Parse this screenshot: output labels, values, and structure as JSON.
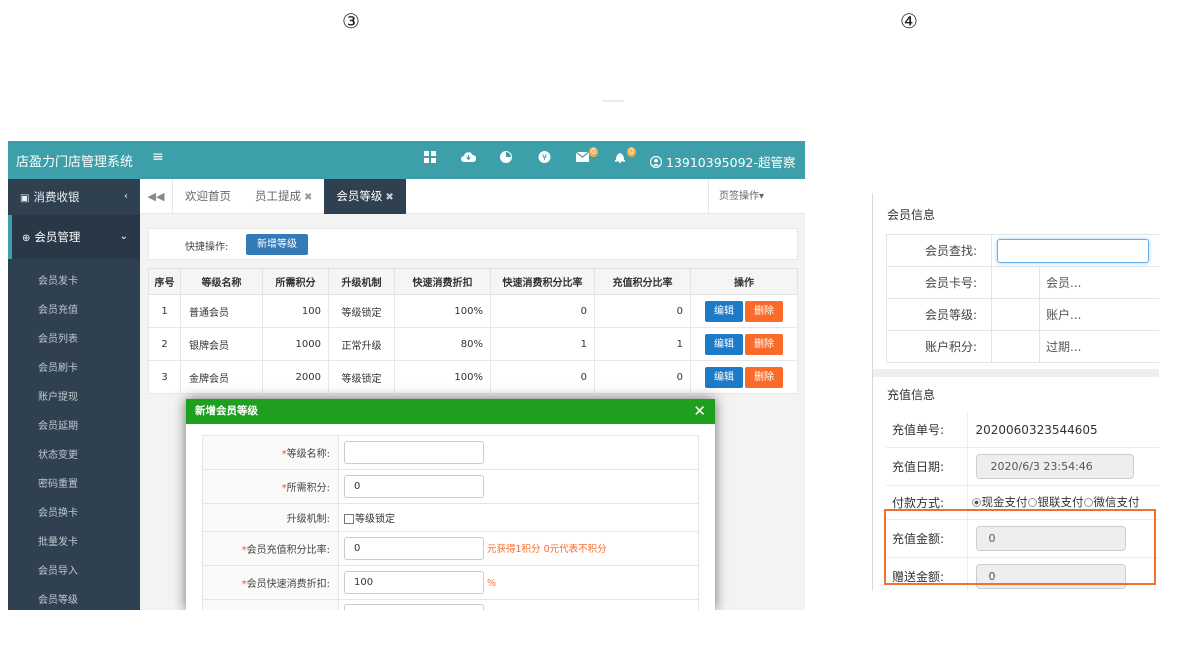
{
  "markers": {
    "left": "③",
    "right": "④"
  },
  "app": {
    "brand": "店盈力门店管理系统",
    "menu_toggle": "≡",
    "topbar_badges": {
      "mail": "0",
      "bell": "0"
    },
    "user": "13910395092-超管察"
  },
  "sidebar": {
    "groups": [
      {
        "label": "消费收银",
        "caret": "‹"
      },
      {
        "label": "会员管理",
        "caret": "⌄"
      }
    ],
    "items": [
      "会员发卡",
      "会员充值",
      "会员列表",
      "会员刷卡",
      "账户提现",
      "会员延期",
      "状态变更",
      "密码重置",
      "会员换卡",
      "批量发卡",
      "会员导入",
      "会员等级"
    ]
  },
  "tabs": {
    "nav_left": "◀◀",
    "items": [
      {
        "label": "欢迎首页",
        "closable": false
      },
      {
        "label": "员工提成",
        "closable": true
      },
      {
        "label": "会员等级",
        "closable": true
      }
    ],
    "close_glyph": "✖",
    "ops": "页签操作▾"
  },
  "quick": {
    "label": "快捷操作:",
    "button": "新增等级"
  },
  "grid": {
    "headers": [
      "序号",
      "等级名称",
      "所需积分",
      "升级机制",
      "快速消费折扣",
      "快速消费积分比率",
      "充值积分比率",
      "操作"
    ],
    "rows": [
      {
        "no": "1",
        "name": "普通会员",
        "points": "100",
        "mechanism": "等级锁定",
        "discount": "100%",
        "consume_ratio": "0",
        "recharge_ratio": "0"
      },
      {
        "no": "2",
        "name": "银牌会员",
        "points": "1000",
        "mechanism": "正常升级",
        "discount": "80%",
        "consume_ratio": "1",
        "recharge_ratio": "1"
      },
      {
        "no": "3",
        "name": "金牌会员",
        "points": "2000",
        "mechanism": "等级锁定",
        "discount": "100%",
        "consume_ratio": "0",
        "recharge_ratio": "0"
      }
    ],
    "edit_label": "编辑",
    "delete_label": "删除"
  },
  "dialog": {
    "title": "新增会员等级",
    "close": "✕",
    "fields": [
      {
        "required": "*",
        "label": "等级名称:",
        "value": ""
      },
      {
        "required": "*",
        "label": "所需积分:",
        "value": "0"
      },
      {
        "required": "",
        "label": "升级机制:",
        "checkbox": "等级锁定"
      },
      {
        "required": "*",
        "label": "会员充值积分比率:",
        "value": "0",
        "hint": "元获得1积分 0元代表不积分"
      },
      {
        "required": "*",
        "label": "会员快速消费折扣:",
        "value": "100",
        "hint": "%"
      }
    ]
  },
  "member_info": {
    "title": "会员信息",
    "search_label": "会员查找:",
    "rows": [
      {
        "label": "会员卡号:",
        "right": "会员..."
      },
      {
        "label": "会员等级:",
        "right": "账户..."
      },
      {
        "label": "账户积分:",
        "right": "过期..."
      }
    ]
  },
  "recharge_info": {
    "title": "充值信息",
    "order_label": "充值单号:",
    "order_no": "2020060323544605",
    "date_label": "充值日期:",
    "date_value": "2020/6/3 23:54:46",
    "pay_label": "付款方式:",
    "pay_options": [
      "现金支付",
      "银联支付",
      "微信支付"
    ],
    "amount_label": "充值金额:",
    "amount_value": "0",
    "gift_label": "赠送金额:",
    "gift_value": "0"
  },
  "colors": {
    "topbar": "#3c9fa9",
    "sidebar": "#2f4050",
    "dialog_header": "#1e9f1e",
    "primary": "#337ab7",
    "danger": "#fa6b2a",
    "highlight": "#f07030"
  }
}
